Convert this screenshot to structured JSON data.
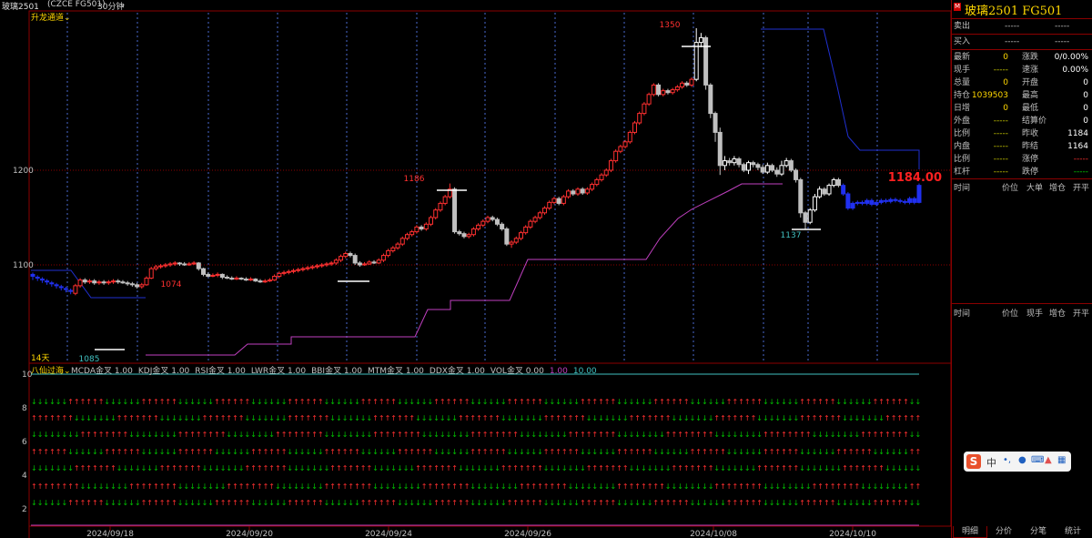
{
  "header": {
    "symbol": "玻璃2501",
    "market": "(CZCE FG501)",
    "period": "30分钟",
    "indicator": "升龙通道"
  },
  "chart": {
    "y_ticks": [
      "1200",
      "1100"
    ],
    "x_dates": [
      "2024/09/18",
      "2024/09/20",
      "2024/09/24",
      "2024/09/26",
      "2024/10/08",
      "2024/10/10"
    ],
    "annotations": {
      "high_1350": "1350",
      "level_1186": "1186",
      "level_1074": "1074",
      "low_1085": "1085",
      "low_1137": "1137",
      "last_price": "1184.00",
      "days": "14天"
    }
  },
  "sub_chart": {
    "title": "八仙过海",
    "legend": [
      "MCDA金叉 1.00",
      "KDJ金叉 1.00",
      "RSI金叉 1.00",
      "LWR金叉 1.00",
      "BBI金叉 1.00",
      "MTM金叉 1.00",
      "DDX金叉 1.00",
      "VOL金叉 0.00",
      "1.00",
      "10.00"
    ],
    "y_ticks": [
      "10",
      "8",
      "6",
      "4",
      "2"
    ]
  },
  "quote_panel": {
    "title": "玻璃2501  FG501",
    "badge": "M",
    "sell": {
      "label": "卖出",
      "price": "-----",
      "vol": "-----"
    },
    "buy": {
      "label": "买入",
      "price": "-----",
      "vol": "-----"
    },
    "rows": [
      {
        "l1": "最新",
        "v1": "0",
        "l2": "涨跌",
        "v2": "0/0.00%"
      },
      {
        "l1": "现手",
        "v1": "-----",
        "l2": "速涨",
        "v2": "0.00%"
      },
      {
        "l1": "总量",
        "v1": "0",
        "l2": "开盘",
        "v2": "0"
      },
      {
        "l1": "持仓",
        "v1": "1039503",
        "l2": "最高",
        "v2": "0"
      },
      {
        "l1": "日增",
        "v1": "0",
        "l2": "最低",
        "v2": "0"
      },
      {
        "l1": "外盘",
        "v1": "-----",
        "l2": "结算价",
        "v2": "0"
      },
      {
        "l1": "比例",
        "v1": "-----",
        "l2": "昨收",
        "v2": "1184"
      },
      {
        "l1": "内盘",
        "v1": "-----",
        "l2": "昨结",
        "v2": "1164"
      },
      {
        "l1": "比例",
        "v1": "-----",
        "l2": "涨停",
        "v2": "-----"
      },
      {
        "l1": "杠杆",
        "v1": "-----",
        "l2": "跌停",
        "v2": "-----"
      }
    ],
    "table1_headers": [
      "时间",
      "价位",
      "大单",
      "增仓",
      "开平"
    ],
    "table2_headers": [
      "时间",
      "价位",
      "现手",
      "增仓",
      "开平"
    ],
    "tabs": [
      "明细",
      "分价",
      "分笔",
      "统计"
    ],
    "colors": {
      "up": "#ff3030",
      "down": "#00d000",
      "neutral": "#c0c0c0",
      "yellow": "#ffd700"
    }
  },
  "ime": {
    "label_zh": "中"
  },
  "candles": [
    [
      1088,
      1090,
      1084,
      1092
    ],
    [
      1086,
      1087,
      1083,
      1089
    ],
    [
      1084,
      1085,
      1081,
      1087
    ],
    [
      1082,
      1083,
      1079,
      1085
    ],
    [
      1080,
      1081,
      1077,
      1083
    ],
    [
      1078,
      1079,
      1075,
      1081
    ],
    [
      1076,
      1077,
      1073,
      1079
    ],
    [
      1074,
      1075,
      1071,
      1077
    ],
    [
      1072,
      1073,
      1069,
      1075
    ],
    [
      1070,
      1078,
      1068,
      1080
    ],
    [
      1078,
      1084,
      1076,
      1086
    ],
    [
      1084,
      1082,
      1080,
      1086
    ],
    [
      1082,
      1083,
      1080,
      1085
    ],
    [
      1083,
      1081,
      1079,
      1085
    ],
    [
      1081,
      1082,
      1079,
      1084
    ],
    [
      1082,
      1081,
      1079,
      1084
    ],
    [
      1081,
      1082,
      1079,
      1084
    ],
    [
      1082,
      1083,
      1080,
      1085
    ],
    [
      1083,
      1082,
      1080,
      1085
    ],
    [
      1082,
      1081,
      1080,
      1084
    ],
    [
      1081,
      1080,
      1078,
      1083
    ],
    [
      1080,
      1079,
      1077,
      1082
    ],
    [
      1079,
      1077,
      1075,
      1081
    ],
    [
      1077,
      1079,
      1075,
      1081
    ],
    [
      1079,
      1086,
      1078,
      1088
    ],
    [
      1086,
      1096,
      1085,
      1098
    ],
    [
      1096,
      1098,
      1094,
      1100
    ],
    [
      1098,
      1099,
      1096,
      1101
    ],
    [
      1099,
      1100,
      1097,
      1102
    ],
    [
      1100,
      1101,
      1098,
      1103
    ],
    [
      1101,
      1102,
      1099,
      1104
    ],
    [
      1102,
      1101,
      1099,
      1103
    ],
    [
      1101,
      1100,
      1099,
      1103
    ],
    [
      1100,
      1101,
      1099,
      1103
    ],
    [
      1101,
      1102,
      1100,
      1104
    ],
    [
      1102,
      1096,
      1094,
      1103
    ],
    [
      1096,
      1090,
      1088,
      1097
    ],
    [
      1090,
      1088,
      1087,
      1092
    ],
    [
      1088,
      1089,
      1087,
      1091
    ],
    [
      1089,
      1090,
      1087,
      1092
    ],
    [
      1090,
      1087,
      1085,
      1091
    ],
    [
      1087,
      1086,
      1085,
      1089
    ],
    [
      1086,
      1085,
      1084,
      1088
    ],
    [
      1085,
      1086,
      1084,
      1088
    ],
    [
      1086,
      1085,
      1084,
      1087
    ],
    [
      1085,
      1084,
      1083,
      1087
    ],
    [
      1084,
      1085,
      1083,
      1087
    ],
    [
      1085,
      1083,
      1082,
      1086
    ],
    [
      1083,
      1082,
      1081,
      1085
    ],
    [
      1082,
      1083,
      1081,
      1085
    ],
    [
      1083,
      1084,
      1082,
      1086
    ],
    [
      1084,
      1088,
      1083,
      1090
    ],
    [
      1088,
      1091,
      1086,
      1093
    ],
    [
      1091,
      1092,
      1089,
      1094
    ],
    [
      1092,
      1093,
      1090,
      1095
    ],
    [
      1093,
      1094,
      1091,
      1096
    ],
    [
      1094,
      1095,
      1092,
      1097
    ],
    [
      1095,
      1096,
      1093,
      1098
    ],
    [
      1096,
      1097,
      1094,
      1099
    ],
    [
      1097,
      1098,
      1095,
      1100
    ],
    [
      1098,
      1099,
      1096,
      1101
    ],
    [
      1099,
      1100,
      1097,
      1102
    ],
    [
      1100,
      1101,
      1098,
      1103
    ],
    [
      1101,
      1102,
      1099,
      1104
    ],
    [
      1102,
      1105,
      1100,
      1107
    ],
    [
      1105,
      1109,
      1103,
      1111
    ],
    [
      1109,
      1112,
      1107,
      1114
    ],
    [
      1112,
      1110,
      1108,
      1114
    ],
    [
      1110,
      1102,
      1100,
      1112
    ],
    [
      1102,
      1100,
      1098,
      1104
    ],
    [
      1100,
      1101,
      1099,
      1103
    ],
    [
      1101,
      1103,
      1100,
      1105
    ],
    [
      1103,
      1102,
      1101,
      1105
    ],
    [
      1102,
      1105,
      1101,
      1107
    ],
    [
      1105,
      1110,
      1103,
      1112
    ],
    [
      1110,
      1115,
      1108,
      1117
    ],
    [
      1115,
      1118,
      1113,
      1120
    ],
    [
      1118,
      1122,
      1116,
      1124
    ],
    [
      1122,
      1128,
      1120,
      1130
    ],
    [
      1128,
      1132,
      1126,
      1134
    ],
    [
      1132,
      1135,
      1130,
      1137
    ],
    [
      1135,
      1140,
      1133,
      1142
    ],
    [
      1140,
      1138,
      1136,
      1142
    ],
    [
      1138,
      1143,
      1136,
      1145
    ],
    [
      1143,
      1150,
      1141,
      1152
    ],
    [
      1150,
      1158,
      1148,
      1160
    ],
    [
      1158,
      1165,
      1156,
      1167
    ],
    [
      1165,
      1172,
      1163,
      1174
    ],
    [
      1172,
      1180,
      1170,
      1186
    ],
    [
      1180,
      1135,
      1133,
      1182
    ],
    [
      1135,
      1133,
      1131,
      1137
    ],
    [
      1133,
      1130,
      1128,
      1135
    ],
    [
      1130,
      1132,
      1128,
      1134
    ],
    [
      1132,
      1138,
      1130,
      1140
    ],
    [
      1138,
      1142,
      1136,
      1144
    ],
    [
      1142,
      1146,
      1140,
      1148
    ],
    [
      1146,
      1150,
      1144,
      1152
    ],
    [
      1150,
      1148,
      1146,
      1152
    ],
    [
      1148,
      1143,
      1141,
      1150
    ],
    [
      1143,
      1138,
      1136,
      1145
    ],
    [
      1138,
      1122,
      1120,
      1140
    ],
    [
      1122,
      1124,
      1118,
      1126
    ],
    [
      1124,
      1128,
      1122,
      1130
    ],
    [
      1128,
      1134,
      1126,
      1136
    ],
    [
      1134,
      1140,
      1132,
      1142
    ],
    [
      1140,
      1146,
      1138,
      1148
    ],
    [
      1146,
      1150,
      1144,
      1152
    ],
    [
      1150,
      1155,
      1148,
      1157
    ],
    [
      1155,
      1160,
      1153,
      1162
    ],
    [
      1160,
      1166,
      1158,
      1168
    ],
    [
      1166,
      1170,
      1164,
      1172
    ],
    [
      1170,
      1165,
      1163,
      1172
    ],
    [
      1165,
      1172,
      1163,
      1174
    ],
    [
      1172,
      1178,
      1170,
      1180
    ],
    [
      1178,
      1175,
      1173,
      1180
    ],
    [
      1175,
      1180,
      1173,
      1182
    ],
    [
      1180,
      1176,
      1174,
      1182
    ],
    [
      1176,
      1180,
      1174,
      1182
    ],
    [
      1180,
      1185,
      1178,
      1187
    ],
    [
      1185,
      1190,
      1183,
      1192
    ],
    [
      1190,
      1195,
      1188,
      1197
    ],
    [
      1195,
      1200,
      1193,
      1202
    ],
    [
      1200,
      1210,
      1198,
      1212
    ],
    [
      1210,
      1220,
      1208,
      1222
    ],
    [
      1220,
      1225,
      1218,
      1227
    ],
    [
      1225,
      1230,
      1223,
      1232
    ],
    [
      1230,
      1240,
      1228,
      1242
    ],
    [
      1240,
      1250,
      1238,
      1252
    ],
    [
      1250,
      1260,
      1248,
      1262
    ],
    [
      1260,
      1270,
      1258,
      1272
    ],
    [
      1270,
      1280,
      1268,
      1282
    ],
    [
      1280,
      1290,
      1278,
      1292
    ],
    [
      1290,
      1280,
      1278,
      1292
    ],
    [
      1280,
      1284,
      1278,
      1286
    ],
    [
      1284,
      1282,
      1280,
      1286
    ],
    [
      1282,
      1285,
      1280,
      1287
    ],
    [
      1285,
      1288,
      1283,
      1290
    ],
    [
      1288,
      1292,
      1286,
      1294
    ],
    [
      1292,
      1290,
      1288,
      1294
    ],
    [
      1290,
      1296,
      1288,
      1298
    ],
    [
      1296,
      1335,
      1294,
      1350
    ],
    [
      1335,
      1340,
      1330,
      1345
    ],
    [
      1340,
      1290,
      1285,
      1342
    ],
    [
      1290,
      1260,
      1255,
      1292
    ],
    [
      1260,
      1240,
      1230,
      1262
    ],
    [
      1240,
      1205,
      1195,
      1245
    ],
    [
      1205,
      1210,
      1200,
      1215
    ],
    [
      1210,
      1208,
      1205,
      1213
    ],
    [
      1208,
      1212,
      1205,
      1215
    ],
    [
      1212,
      1206,
      1203,
      1214
    ],
    [
      1206,
      1200,
      1198,
      1208
    ],
    [
      1200,
      1208,
      1196,
      1210
    ],
    [
      1208,
      1206,
      1203,
      1210
    ],
    [
      1206,
      1203,
      1200,
      1208
    ],
    [
      1203,
      1198,
      1196,
      1206
    ],
    [
      1198,
      1205,
      1196,
      1208
    ],
    [
      1205,
      1200,
      1198,
      1207
    ],
    [
      1200,
      1196,
      1193,
      1203
    ],
    [
      1196,
      1205,
      1194,
      1210
    ],
    [
      1205,
      1210,
      1203,
      1213
    ],
    [
      1210,
      1200,
      1198,
      1212
    ],
    [
      1200,
      1190,
      1187,
      1202
    ],
    [
      1190,
      1155,
      1150,
      1192
    ],
    [
      1155,
      1145,
      1137,
      1157
    ],
    [
      1145,
      1158,
      1143,
      1160
    ],
    [
      1158,
      1172,
      1156,
      1175
    ],
    [
      1172,
      1180,
      1170,
      1183
    ],
    [
      1180,
      1175,
      1173,
      1182
    ],
    [
      1175,
      1184,
      1173,
      1186
    ],
    [
      1184,
      1190,
      1182,
      1192
    ],
    [
      1190,
      1184,
      1182,
      1192
    ],
    [
      1184,
      1175,
      1173,
      1186
    ],
    [
      1175,
      1160,
      1158,
      1177
    ],
    [
      1160,
      1165,
      1158,
      1167
    ],
    [
      1165,
      1166,
      1163,
      1168
    ],
    [
      1166,
      1165,
      1163,
      1168
    ],
    [
      1165,
      1168,
      1163,
      1170
    ],
    [
      1168,
      1164,
      1162,
      1170
    ],
    [
      1164,
      1166,
      1162,
      1168
    ],
    [
      1166,
      1168,
      1164,
      1170
    ],
    [
      1168,
      1167,
      1165,
      1170
    ],
    [
      1167,
      1169,
      1165,
      1171
    ],
    [
      1169,
      1168,
      1166,
      1171
    ],
    [
      1168,
      1167,
      1165,
      1170
    ],
    [
      1167,
      1166,
      1164,
      1169
    ],
    [
      1166,
      1170,
      1164,
      1172
    ],
    [
      1170,
      1166,
      1164,
      1172
    ],
    [
      1166,
      1184,
      1165,
      1186
    ]
  ]
}
